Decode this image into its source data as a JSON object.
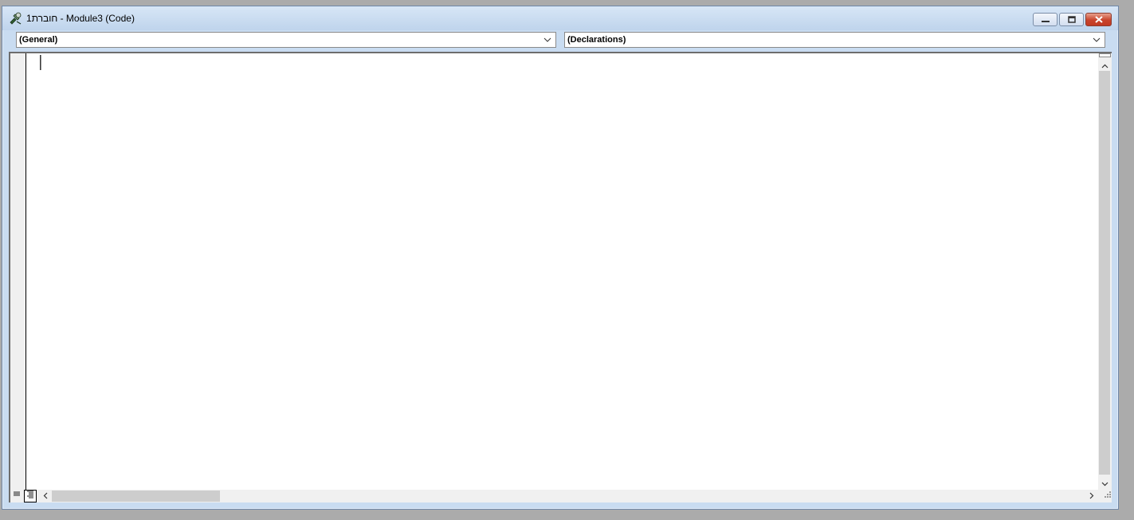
{
  "window": {
    "title": "חוברת1 - Module3 (Code)",
    "icons": {
      "app": "vba-module-icon",
      "minimize": "minimize-icon",
      "maximize": "maximize-icon",
      "close": "close-icon"
    }
  },
  "object_combo": {
    "selected": "(General)"
  },
  "procedure_combo": {
    "selected": "(Declarations)"
  },
  "editor": {
    "content": ""
  },
  "view_buttons": {
    "procedure_view": "procedure-view-icon",
    "full_module_view": "full-module-view-icon",
    "active": "full_module_view"
  },
  "colors": {
    "window_frame": "#c9dcf1",
    "close_button": "#c8432c",
    "scrollbar_thumb": "#cdcdcd",
    "editor_background": "#ffffff"
  }
}
